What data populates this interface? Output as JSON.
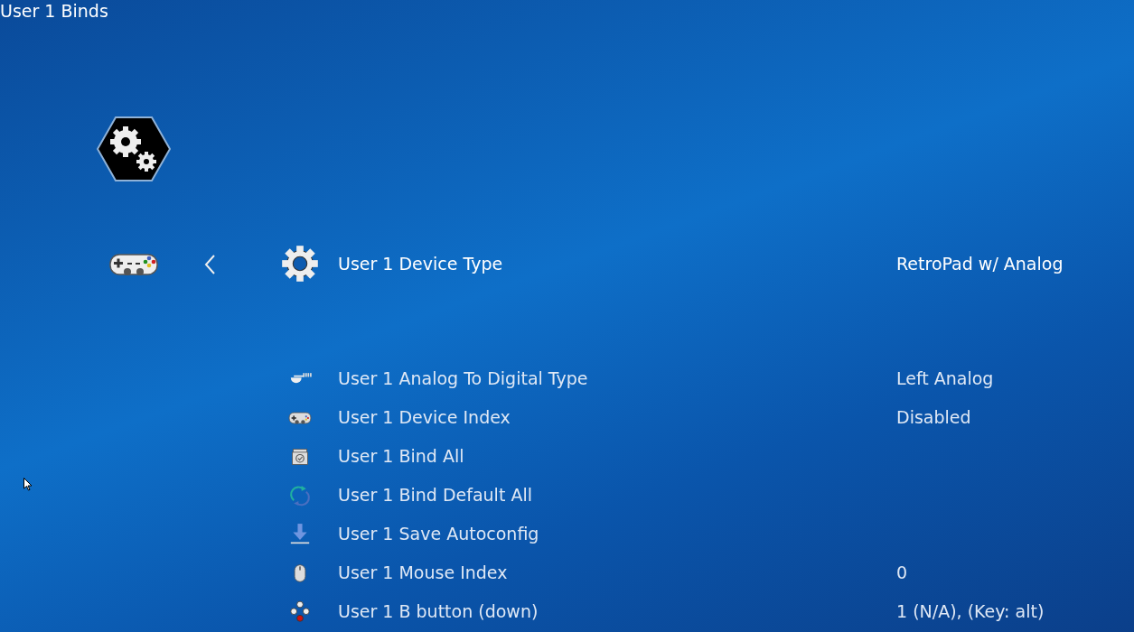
{
  "window": {
    "title": "User 1 Binds"
  },
  "items": [
    {
      "kind": "settings",
      "label": "User 1 Device Type",
      "value": "RetroPad w/ Analog",
      "selected": true
    },
    {
      "kind": "analog",
      "label": "User 1 Analog To Digital Type",
      "value": "Left Analog",
      "selected": false
    },
    {
      "kind": "gamepad",
      "label": "User 1 Device Index",
      "value": "Disabled",
      "selected": false
    },
    {
      "kind": "bind",
      "label": "User 1 Bind All",
      "selected": false
    },
    {
      "kind": "refresh",
      "label": "User 1 Bind Default All",
      "selected": false
    },
    {
      "kind": "save",
      "label": "User 1 Save Autoconfig",
      "selected": false
    },
    {
      "kind": "mouse",
      "label": "User 1 Mouse Index",
      "value": "0",
      "selected": false
    },
    {
      "kind": "buttons",
      "label": "User 1 B button (down)",
      "value": "1 (N/A), (Key: alt)",
      "selected": false
    }
  ]
}
